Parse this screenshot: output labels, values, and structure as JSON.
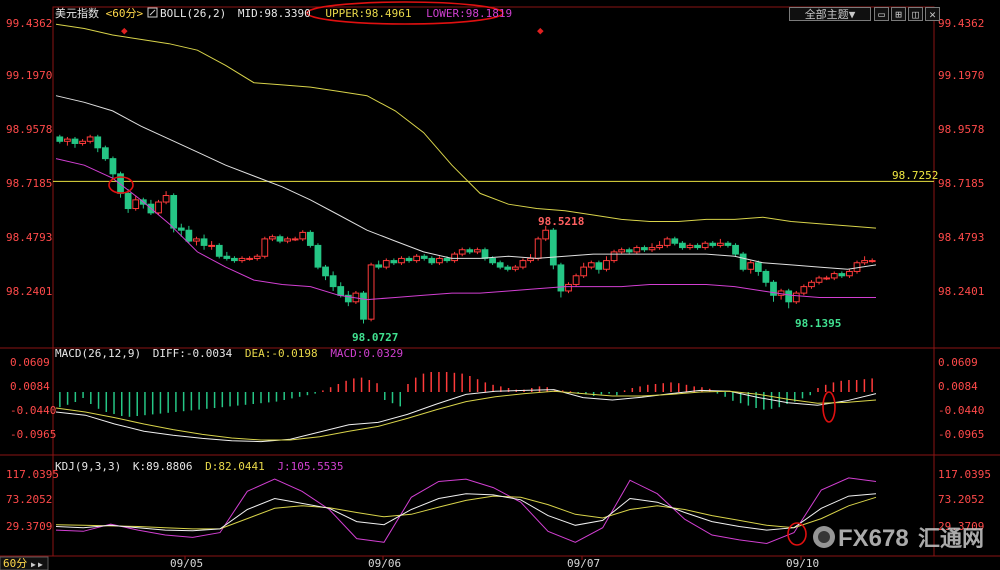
{
  "header": {
    "symbol": "美元指数",
    "period": "<60分>",
    "boll_label": "BOLL(26,2)",
    "mid": "MID:98.3390",
    "upper": "UPPER:98.4961",
    "lower": "LOWER:98.1819",
    "theme_button": "全部主题",
    "theme_arrow": "▼"
  },
  "price_axis": {
    "ticks": [
      "99.4362",
      "99.1970",
      "98.9578",
      "98.7185",
      "98.4793",
      "98.2401"
    ],
    "hline_value": "98.7252"
  },
  "annotations": {
    "high": "98.5218",
    "low1": "98.0727",
    "low2": "98.1395"
  },
  "macd_header": {
    "label": "MACD(26,12,9)",
    "diff": "DIFF:-0.0034",
    "dea": "DEA:-0.0198",
    "macd": "MACD:0.0329"
  },
  "macd_axis": {
    "ticks": [
      "0.0609",
      "0.0084",
      "-0.0440",
      "-0.0965"
    ]
  },
  "kdj_header": {
    "label": "KDJ(9,3,3)",
    "k": "K:89.8806",
    "d": "D:82.0441",
    "j": "J:105.5535"
  },
  "kdj_axis": {
    "ticks": [
      "117.0395",
      "73.2052",
      "29.3709"
    ]
  },
  "time_axis": {
    "period_label": "60分",
    "dates": [
      "09/05",
      "09/06",
      "09/07",
      "09/10"
    ]
  },
  "watermark": {
    "brand": "FX678",
    "cn": "汇通网"
  },
  "colors": {
    "up": "#ff3b3b",
    "down": "#25c685",
    "upper": "#d8d34a",
    "lower": "#d23fd2",
    "mid": "#e0e0e0",
    "hline": "#e8e040",
    "axis": "#a01818",
    "label_red": "#ff4a4a"
  },
  "chart_data": {
    "type": "candlestick",
    "title": "美元指数 60分",
    "price_range": [
      98.04,
      99.46
    ],
    "candles": [
      [
        98.93,
        98.91,
        98.94,
        98.9
      ],
      [
        98.91,
        98.92,
        98.93,
        98.89
      ],
      [
        98.92,
        98.9,
        98.93,
        98.88
      ],
      [
        98.9,
        98.91,
        98.92,
        98.89
      ],
      [
        98.91,
        98.93,
        98.94,
        98.9
      ],
      [
        98.93,
        98.88,
        98.94,
        98.86
      ],
      [
        98.88,
        98.83,
        98.89,
        98.82
      ],
      [
        98.83,
        98.76,
        98.84,
        98.74
      ],
      [
        98.76,
        98.67,
        98.77,
        98.65
      ],
      [
        98.67,
        98.6,
        98.69,
        98.58
      ],
      [
        98.6,
        98.64,
        98.66,
        98.59
      ],
      [
        98.64,
        98.62,
        98.65,
        98.6
      ],
      [
        98.62,
        98.58,
        98.64,
        98.57
      ],
      [
        98.58,
        98.63,
        98.64,
        98.57
      ],
      [
        98.63,
        98.66,
        98.68,
        98.62
      ],
      [
        98.66,
        98.51,
        98.67,
        98.49
      ],
      [
        98.51,
        98.5,
        98.53,
        98.47
      ],
      [
        98.5,
        98.45,
        98.52,
        98.44
      ],
      [
        98.45,
        98.46,
        98.47,
        98.43
      ],
      [
        98.46,
        98.43,
        98.48,
        98.41
      ],
      [
        98.43,
        98.43,
        98.45,
        98.41
      ],
      [
        98.43,
        98.38,
        98.44,
        98.37
      ],
      [
        98.38,
        98.37,
        98.4,
        98.36
      ],
      [
        98.37,
        98.36,
        98.38,
        98.35
      ],
      [
        98.36,
        98.37,
        98.38,
        98.35
      ],
      [
        98.37,
        98.37,
        98.38,
        98.36
      ],
      [
        98.37,
        98.38,
        98.39,
        98.36
      ],
      [
        98.38,
        98.46,
        98.47,
        98.37
      ],
      [
        98.46,
        98.47,
        98.48,
        98.45
      ],
      [
        98.47,
        98.45,
        98.48,
        98.44
      ],
      [
        98.45,
        98.46,
        98.47,
        98.44
      ],
      [
        98.46,
        98.46,
        98.47,
        98.45
      ],
      [
        98.46,
        98.49,
        98.5,
        98.45
      ],
      [
        98.49,
        98.43,
        98.5,
        98.42
      ],
      [
        98.43,
        98.33,
        98.44,
        98.32
      ],
      [
        98.33,
        98.29,
        98.34,
        98.27
      ],
      [
        98.29,
        98.24,
        98.31,
        98.22
      ],
      [
        98.24,
        98.2,
        98.26,
        98.19
      ],
      [
        98.2,
        98.17,
        98.22,
        98.15
      ],
      [
        98.17,
        98.21,
        98.22,
        98.16
      ],
      [
        98.21,
        98.09,
        98.22,
        98.07
      ],
      [
        98.09,
        98.34,
        98.35,
        98.08
      ],
      [
        98.34,
        98.33,
        98.36,
        98.32
      ],
      [
        98.33,
        98.36,
        98.37,
        98.32
      ],
      [
        98.36,
        98.35,
        98.37,
        98.34
      ],
      [
        98.35,
        98.37,
        98.38,
        98.34
      ],
      [
        98.37,
        98.36,
        98.38,
        98.35
      ],
      [
        98.36,
        98.38,
        98.39,
        98.35
      ],
      [
        98.38,
        98.37,
        98.39,
        98.36
      ],
      [
        98.37,
        98.35,
        98.38,
        98.34
      ],
      [
        98.35,
        98.37,
        98.38,
        98.34
      ],
      [
        98.37,
        98.36,
        98.38,
        98.35
      ],
      [
        98.36,
        98.39,
        98.4,
        98.35
      ],
      [
        98.39,
        98.41,
        98.42,
        98.38
      ],
      [
        98.41,
        98.4,
        98.42,
        98.39
      ],
      [
        98.4,
        98.41,
        98.42,
        98.39
      ],
      [
        98.41,
        98.37,
        98.42,
        98.36
      ],
      [
        98.37,
        98.35,
        98.38,
        98.34
      ],
      [
        98.35,
        98.33,
        98.36,
        98.32
      ],
      [
        98.33,
        98.32,
        98.34,
        98.31
      ],
      [
        98.32,
        98.33,
        98.34,
        98.31
      ],
      [
        98.33,
        98.36,
        98.37,
        98.32
      ],
      [
        98.36,
        98.37,
        98.39,
        98.35
      ],
      [
        98.37,
        98.46,
        98.47,
        98.36
      ],
      [
        98.46,
        98.5,
        98.52,
        98.45
      ],
      [
        98.5,
        98.34,
        98.51,
        98.32
      ],
      [
        98.34,
        98.22,
        98.35,
        98.19
      ],
      [
        98.22,
        98.25,
        98.26,
        98.21
      ],
      [
        98.25,
        98.29,
        98.3,
        98.24
      ],
      [
        98.29,
        98.33,
        98.35,
        98.28
      ],
      [
        98.33,
        98.35,
        98.36,
        98.32
      ],
      [
        98.35,
        98.32,
        98.36,
        98.3
      ],
      [
        98.32,
        98.36,
        98.38,
        98.31
      ],
      [
        98.36,
        98.4,
        98.41,
        98.35
      ],
      [
        98.4,
        98.41,
        98.42,
        98.39
      ],
      [
        98.41,
        98.4,
        98.42,
        98.39
      ],
      [
        98.4,
        98.42,
        98.43,
        98.39
      ],
      [
        98.42,
        98.41,
        98.43,
        98.4
      ],
      [
        98.41,
        98.42,
        98.44,
        98.4
      ],
      [
        98.42,
        98.43,
        98.45,
        98.41
      ],
      [
        98.43,
        98.46,
        98.47,
        98.42
      ],
      [
        98.46,
        98.44,
        98.47,
        98.43
      ],
      [
        98.44,
        98.42,
        98.45,
        98.41
      ],
      [
        98.42,
        98.43,
        98.44,
        98.41
      ],
      [
        98.43,
        98.42,
        98.44,
        98.41
      ],
      [
        98.42,
        98.44,
        98.45,
        98.41
      ],
      [
        98.44,
        98.43,
        98.45,
        98.42
      ],
      [
        98.43,
        98.44,
        98.46,
        98.42
      ],
      [
        98.44,
        98.43,
        98.45,
        98.42
      ],
      [
        98.43,
        98.39,
        98.44,
        98.38
      ],
      [
        98.39,
        98.32,
        98.4,
        98.31
      ],
      [
        98.32,
        98.35,
        98.36,
        98.3
      ],
      [
        98.35,
        98.31,
        98.36,
        98.29
      ],
      [
        98.31,
        98.26,
        98.32,
        98.24
      ],
      [
        98.26,
        98.2,
        98.27,
        98.17
      ],
      [
        98.2,
        98.22,
        98.23,
        98.18
      ],
      [
        98.22,
        98.17,
        98.23,
        98.14
      ],
      [
        98.17,
        98.21,
        98.22,
        98.16
      ],
      [
        98.21,
        98.24,
        98.25,
        98.2
      ],
      [
        98.24,
        98.26,
        98.27,
        98.23
      ],
      [
        98.26,
        98.28,
        98.29,
        98.25
      ],
      [
        98.28,
        98.28,
        98.29,
        98.27
      ],
      [
        98.28,
        98.3,
        98.31,
        98.27
      ],
      [
        98.3,
        98.29,
        98.31,
        98.28
      ],
      [
        98.29,
        98.31,
        98.32,
        98.28
      ],
      [
        98.31,
        98.35,
        98.36,
        98.3
      ],
      [
        98.35,
        98.36,
        98.38,
        98.34
      ],
      [
        98.36,
        98.36,
        98.37,
        98.35
      ]
    ],
    "upper_line": [
      99.45,
      99.43,
      99.4,
      99.38,
      99.36,
      99.33,
      99.26,
      99.18,
      99.17,
      99.16,
      99.14,
      99.12,
      99.05,
      98.95,
      98.8,
      98.67,
      98.62,
      98.6,
      98.59,
      98.57,
      98.55,
      98.54,
      98.54,
      98.55,
      98.55,
      98.56,
      98.54,
      98.53,
      98.52,
      98.51
    ],
    "mid_line": [
      99.12,
      99.09,
      99.05,
      98.98,
      98.92,
      98.86,
      98.8,
      98.75,
      98.7,
      98.64,
      98.57,
      98.5,
      98.45,
      98.4,
      98.37,
      98.37,
      98.38,
      98.37,
      98.38,
      98.39,
      98.39,
      98.39,
      98.39,
      98.39,
      98.38,
      98.35,
      98.34,
      98.33,
      98.32,
      98.34
    ],
    "lower_line": [
      98.83,
      98.8,
      98.74,
      98.64,
      98.53,
      98.4,
      98.33,
      98.27,
      98.25,
      98.24,
      98.2,
      98.18,
      98.19,
      98.2,
      98.21,
      98.21,
      98.22,
      98.23,
      98.24,
      98.24,
      98.24,
      98.25,
      98.25,
      98.25,
      98.24,
      98.22,
      98.2,
      98.19,
      98.19,
      98.19
    ],
    "macd_range": [
      -0.13,
      0.08
    ],
    "macd_hist": [
      -0.038,
      -0.032,
      -0.025,
      -0.015,
      -0.03,
      -0.042,
      -0.05,
      -0.055,
      -0.06,
      -0.062,
      -0.06,
      -0.058,
      -0.056,
      -0.054,
      -0.052,
      -0.05,
      -0.048,
      -0.046,
      -0.044,
      -0.042,
      -0.04,
      -0.038,
      -0.036,
      -0.034,
      -0.032,
      -0.03,
      -0.028,
      -0.026,
      -0.024,
      -0.02,
      -0.016,
      -0.012,
      -0.008,
      -0.004,
      0.004,
      0.012,
      0.02,
      0.028,
      0.034,
      0.036,
      0.03,
      0.022,
      -0.02,
      -0.028,
      -0.036,
      0.02,
      0.036,
      0.046,
      0.05,
      0.05,
      0.05,
      0.048,
      0.046,
      0.04,
      0.032,
      0.024,
      0.018,
      0.014,
      0.01,
      0.006,
      0.006,
      0.01,
      0.014,
      0.012,
      0.006,
      0.004,
      0.002,
      -0.004,
      -0.006,
      -0.01,
      -0.006,
      -0.004,
      -0.008,
      0.004,
      0.01,
      0.014,
      0.018,
      0.02,
      0.022,
      0.024,
      0.022,
      0.018,
      0.014,
      0.012,
      0.008,
      -0.004,
      -0.012,
      -0.022,
      -0.028,
      -0.034,
      -0.04,
      -0.044,
      -0.042,
      -0.038,
      -0.03,
      -0.024,
      -0.016,
      -0.008,
      0.01,
      0.018,
      0.024,
      0.028,
      0.03,
      0.03,
      0.032,
      0.034
    ],
    "diff_line": [
      -0.05,
      -0.058,
      -0.08,
      -0.098,
      -0.108,
      -0.116,
      -0.122,
      -0.124,
      -0.118,
      -0.1,
      -0.082,
      -0.076,
      -0.056,
      -0.03,
      -0.006,
      0.002,
      0.004,
      0.006,
      -0.014,
      -0.02,
      -0.013,
      -0.004,
      0.004,
      0.002,
      -0.014,
      -0.027,
      -0.033,
      -0.022,
      -0.004
    ],
    "dea_line": [
      -0.04,
      -0.05,
      -0.064,
      -0.08,
      -0.094,
      -0.106,
      -0.115,
      -0.12,
      -0.12,
      -0.112,
      -0.098,
      -0.086,
      -0.066,
      -0.044,
      -0.024,
      -0.012,
      -0.004,
      0.002,
      -0.004,
      -0.01,
      -0.01,
      -0.006,
      0.0,
      0.002,
      -0.006,
      -0.018,
      -0.028,
      -0.026,
      -0.02
    ],
    "kdj_range": [
      -10,
      125
    ],
    "k_line": [
      32,
      30,
      34,
      30,
      26,
      25,
      28,
      60,
      78,
      70,
      62,
      40,
      35,
      60,
      78,
      86,
      84,
      76,
      50,
      34,
      42,
      78,
      72,
      55,
      40,
      32,
      26,
      30,
      62,
      82,
      86
    ],
    "d_line": [
      35,
      34,
      33,
      32,
      30,
      28,
      28,
      45,
      62,
      66,
      63,
      55,
      48,
      52,
      64,
      75,
      82,
      80,
      68,
      52,
      46,
      60,
      66,
      60,
      50,
      42,
      34,
      30,
      45,
      66,
      80
    ],
    "j_line": [
      26,
      24,
      36,
      26,
      18,
      14,
      22,
      90,
      110,
      90,
      60,
      12,
      6,
      80,
      106,
      110,
      96,
      72,
      24,
      6,
      30,
      108,
      86,
      44,
      18,
      10,
      4,
      22,
      92,
      112,
      106
    ]
  }
}
